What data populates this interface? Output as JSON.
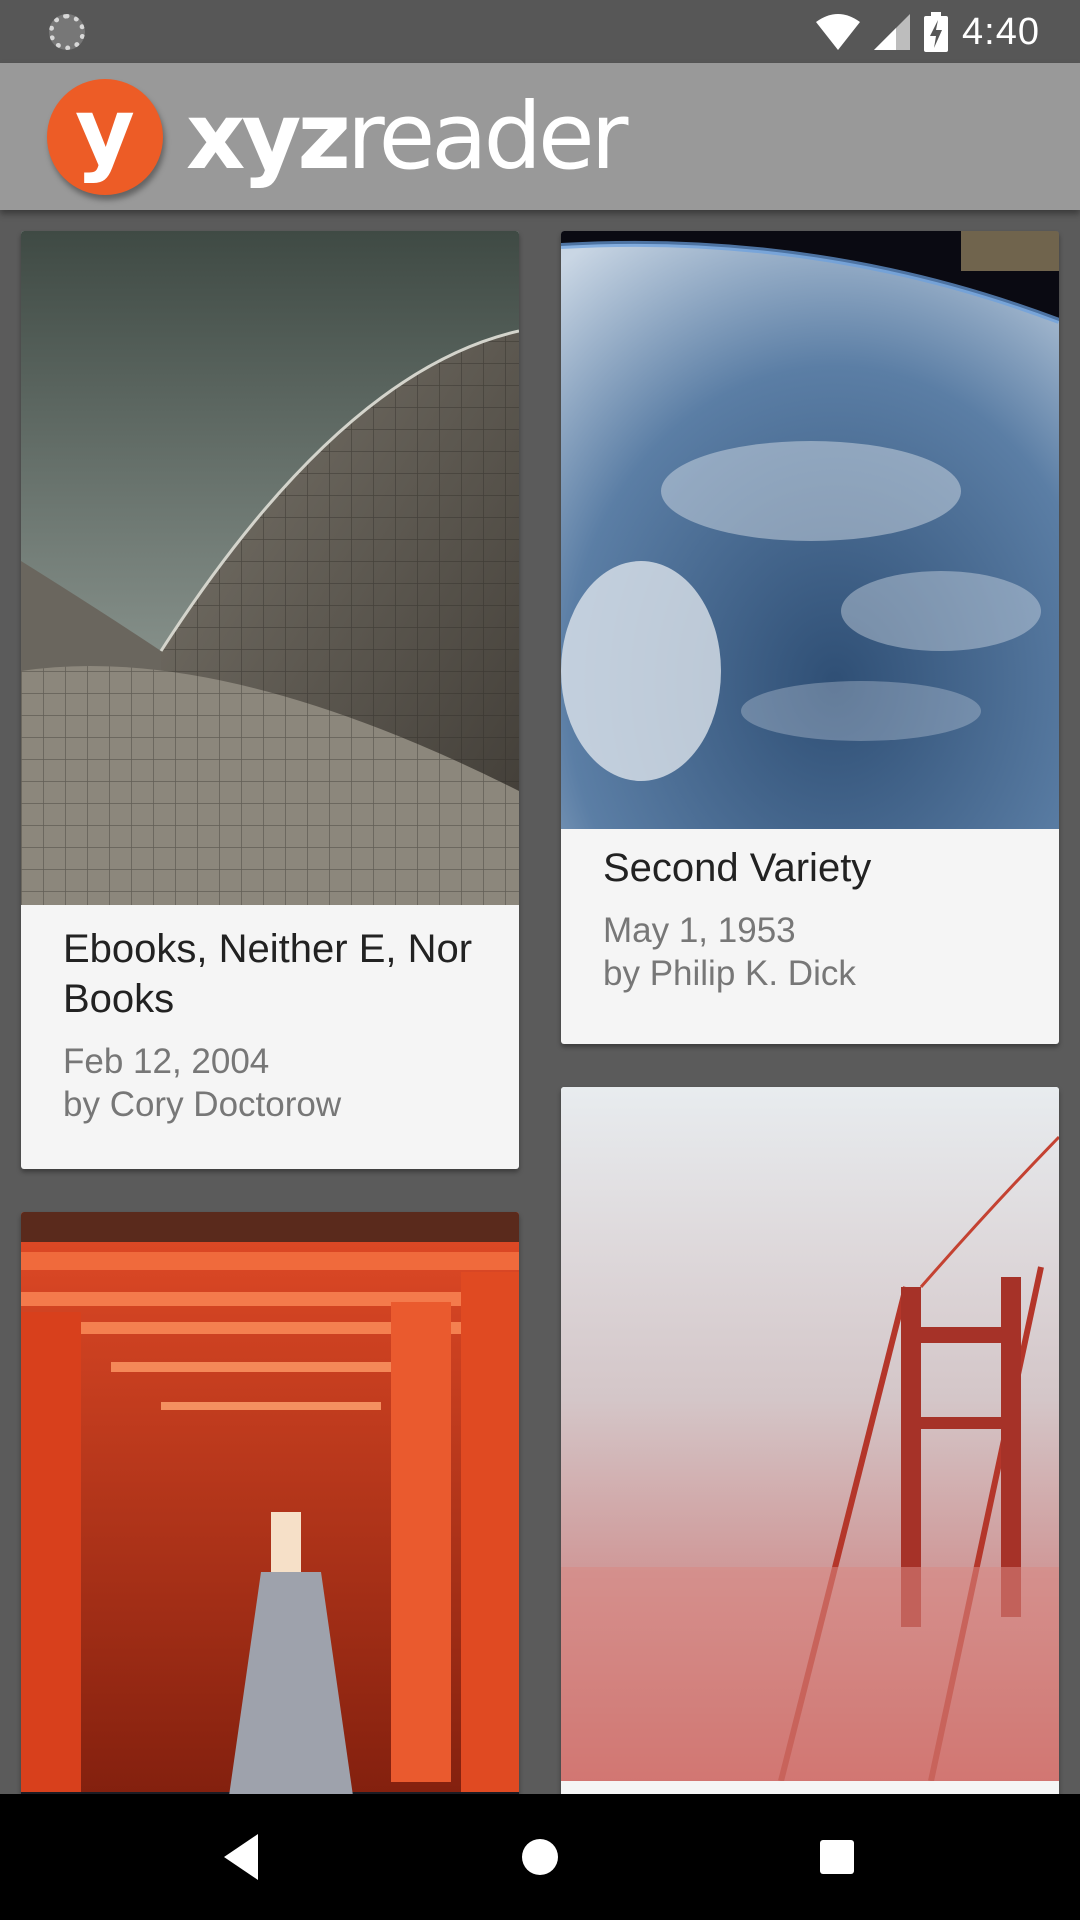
{
  "status_bar": {
    "time": "4:40",
    "icons": [
      "loading-icon",
      "wifi-icon",
      "signal-icon",
      "battery-charging-icon"
    ]
  },
  "app_bar": {
    "logo_letter": "y",
    "title_bold": "xyz",
    "title_regular": "reader",
    "brand_color": "#ed5c26"
  },
  "articles": [
    {
      "title": "Ebooks, Neither E, Nor Books",
      "date": "Feb 12, 2004",
      "author": "by Cory Doctorow",
      "image": "opera-house-roof-photo"
    },
    {
      "title": "Second Variety",
      "date": "May 1, 1953",
      "author": "by Philip K. Dick",
      "image": "earth-from-space-photo"
    },
    {
      "title": "",
      "date": "",
      "author": "",
      "image": "torii-gates-photo"
    },
    {
      "title": "",
      "date": "",
      "author": "",
      "image": "golden-gate-fog-photo"
    }
  ],
  "nav_bar": {
    "icons": [
      "back-icon",
      "home-icon",
      "recents-icon"
    ]
  }
}
